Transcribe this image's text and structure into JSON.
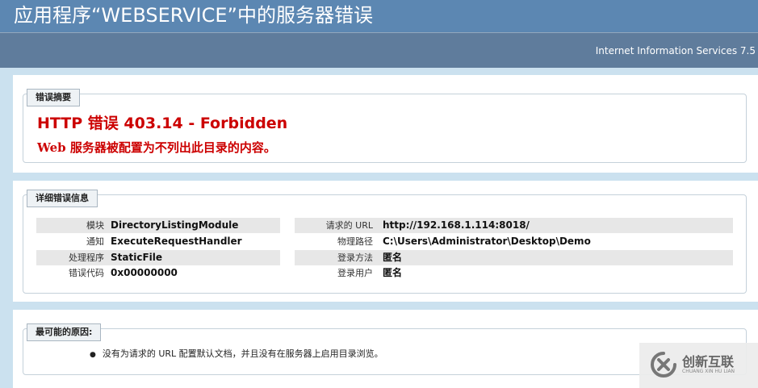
{
  "header": {
    "title": "应用程序“WEBSERVICE”中的服务器错误",
    "server": "Internet Information Services 7.5"
  },
  "summary": {
    "legend": "错误摘要",
    "title": "HTTP 错误 403.14 - Forbidden",
    "description": "Web 服务器被配置为不列出此目录的内容。"
  },
  "details": {
    "legend": "详细错误信息",
    "left": [
      {
        "key": "模块",
        "value": "DirectoryListingModule"
      },
      {
        "key": "通知",
        "value": "ExecuteRequestHandler"
      },
      {
        "key": "处理程序",
        "value": "StaticFile"
      },
      {
        "key": "错误代码",
        "value": "0x00000000"
      }
    ],
    "right": [
      {
        "key": "请求的 URL",
        "value": "http://192.168.1.114:8018/"
      },
      {
        "key": "物理路径",
        "value": "C:\\Users\\Administrator\\Desktop\\Demo"
      },
      {
        "key": "登录方法",
        "value": "匿名"
      },
      {
        "key": "登录用户",
        "value": "匿名"
      }
    ]
  },
  "causes": {
    "legend": "最可能的原因:",
    "items": [
      "没有为请求的 URL 配置默认文档，并且没有在服务器上启用目录浏览。"
    ]
  },
  "watermark": {
    "text": "创新互联",
    "subtext": "CHUANG XIN HU LIAN"
  },
  "colors": {
    "header_bg": "#5c87b2",
    "subheader_bg": "#5f7c9c",
    "page_bg": "#cbe1ef",
    "error_red": "#cc0000"
  }
}
